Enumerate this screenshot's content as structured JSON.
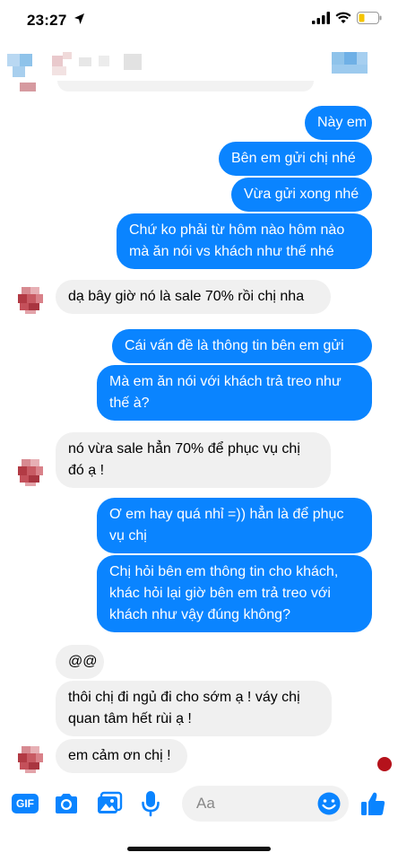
{
  "status": {
    "time": "23:27"
  },
  "messages": [
    {
      "text": "Này em"
    },
    {
      "text": "Bên em gửi chị nhé"
    },
    {
      "text": "Vừa gửi xong nhé"
    },
    {
      "line1": "Chứ ko phải từ hôm nào hôm nào",
      "line2": "mà ăn nói vs khách như thế nhé"
    },
    {
      "text": "dạ bây giờ nó là sale 70% rồi chị nha"
    },
    {
      "text": "Cái vấn đề là thông tin bên em gửi"
    },
    {
      "line1": "Mà em ăn nói với khách trả treo như",
      "line2": "thế à?"
    },
    {
      "line1": "nó vừa sale hẳn 70% để phục vụ chị",
      "line2": "đó ạ !"
    },
    {
      "line1": "Ơ em hay quá nhỉ =)) hẳn là để phục",
      "line2": "vụ chị"
    },
    {
      "line1": "Chị hỏi bên em thông tin cho khách,",
      "line2": "khác hỏi lại giờ bên em trả treo với",
      "line3": "khách như vậy đúng không?"
    },
    {
      "text": "@@"
    },
    {
      "line1": "thôi chị đi ngủ đi cho sớm ạ ! váy chị",
      "line2": "quan tâm hết rùi ạ !"
    },
    {
      "text": "em cảm ơn chị !"
    }
  ],
  "composer": {
    "gif_label": "GIF",
    "placeholder": "Aa",
    "icons": [
      "gif-icon",
      "camera-icon",
      "image-icon",
      "microphone-icon",
      "emoji-icon",
      "thumbs-up-icon"
    ]
  },
  "colors": {
    "outgoing": "#0a84ff",
    "incoming": "#f0f0f0",
    "accent": "#0a84ff"
  }
}
